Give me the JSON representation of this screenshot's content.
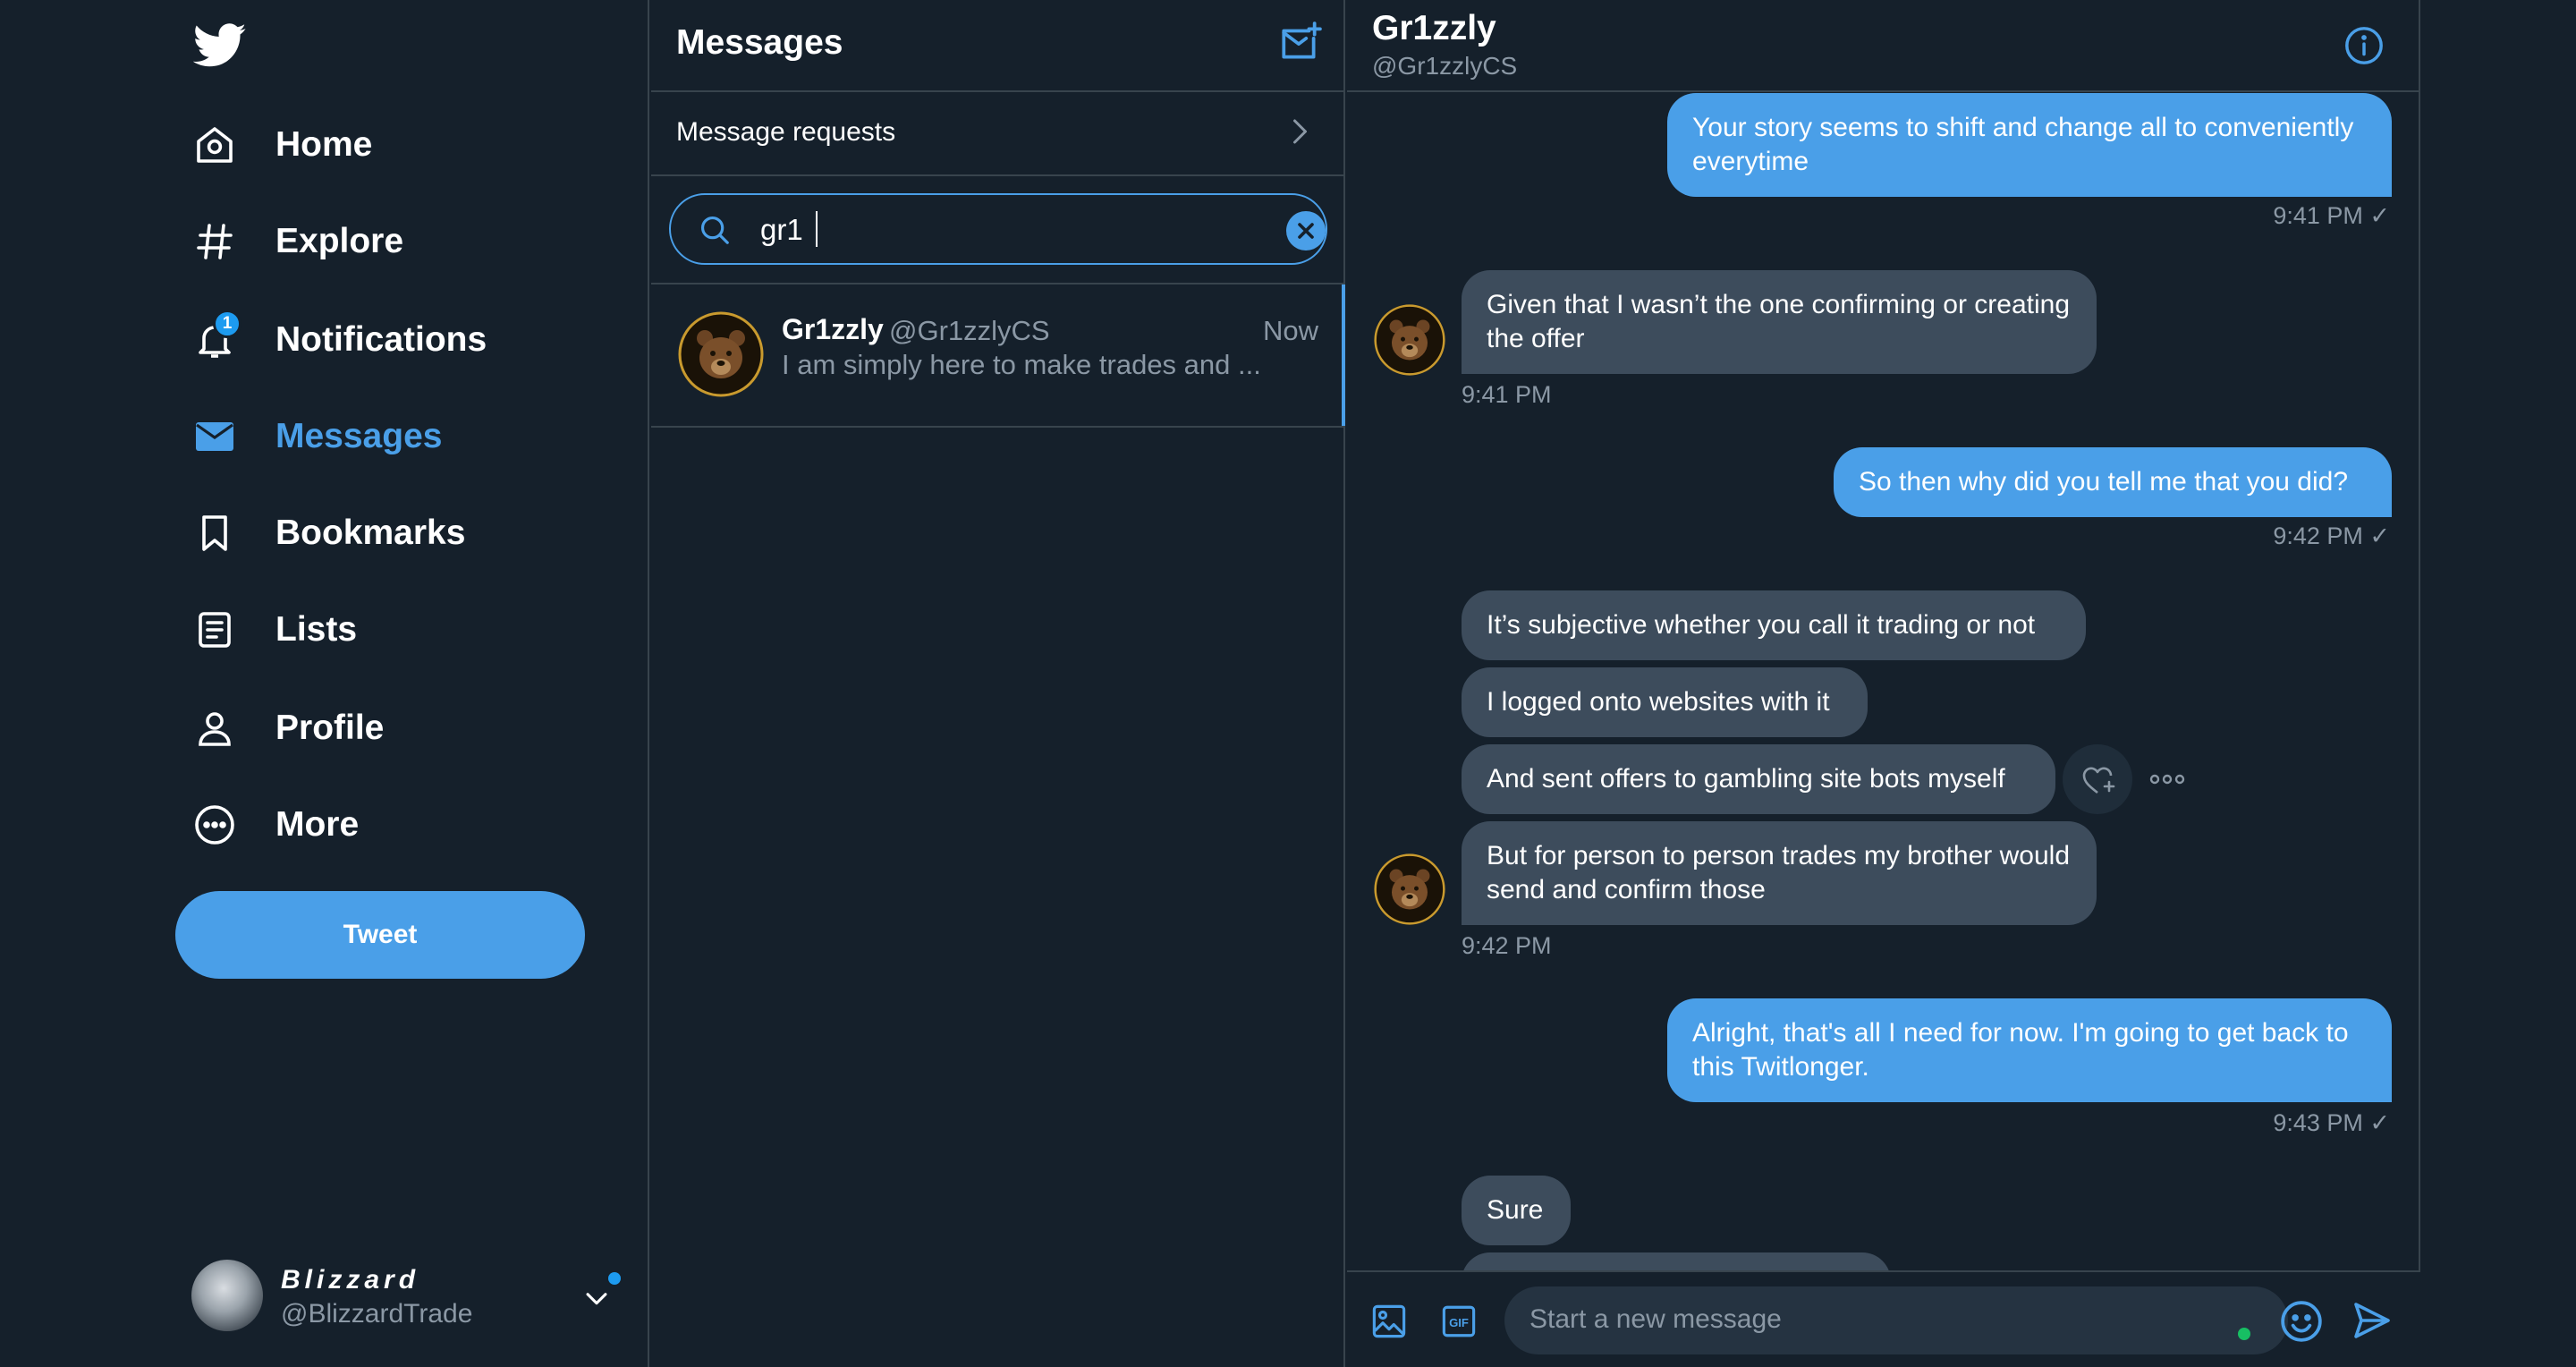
{
  "nav": {
    "items": [
      {
        "label": "Home"
      },
      {
        "label": "Explore"
      },
      {
        "label": "Notifications",
        "badge": "1"
      },
      {
        "label": "Messages"
      },
      {
        "label": "Bookmarks"
      },
      {
        "label": "Lists"
      },
      {
        "label": "Profile"
      },
      {
        "label": "More"
      }
    ],
    "tweet_label": "Tweet",
    "account": {
      "name": "Blizzard",
      "handle": "@BlizzardTrade"
    },
    "accent": "#4a9fe8"
  },
  "list": {
    "title": "Messages",
    "message_requests": "Message requests",
    "search_value": "gr1",
    "conversation": {
      "name": "Gr1zzly",
      "handle": "@Gr1zzlyCS",
      "time": "Now",
      "preview": "I am simply here to make trades and ..."
    }
  },
  "chat": {
    "name": "Gr1zzly",
    "handle": "@Gr1zzlyCS",
    "messages": [
      {
        "dir": "out",
        "text": "Your story seems to shift and change all to conveniently everytime"
      },
      {
        "ts": "9:41 PM ✓"
      },
      {
        "dir": "in",
        "text": "Given that I wasn’t the one confirming or creating the offer"
      },
      {
        "ts": "9:41 PM"
      },
      {
        "dir": "out",
        "text": "So then why did you tell me that you did?"
      },
      {
        "ts": "9:42 PM ✓"
      },
      {
        "dir": "in",
        "text": "It’s subjective whether you call it trading or not"
      },
      {
        "dir": "in",
        "text": "I logged onto websites with it"
      },
      {
        "dir": "in",
        "text": "And sent offers to gambling site bots myself"
      },
      {
        "dir": "in",
        "text": "But for person to person trades my brother would send and confirm those"
      },
      {
        "ts": "9:42 PM"
      },
      {
        "dir": "out",
        "text": "Alright, that's all I need for now. I'm going to get back to this Twitlonger."
      },
      {
        "ts": "9:43 PM ✓"
      },
      {
        "dir": "in",
        "text": "Sure"
      }
    ],
    "composer_placeholder": "Start a new message",
    "gif_label": "GIF"
  }
}
